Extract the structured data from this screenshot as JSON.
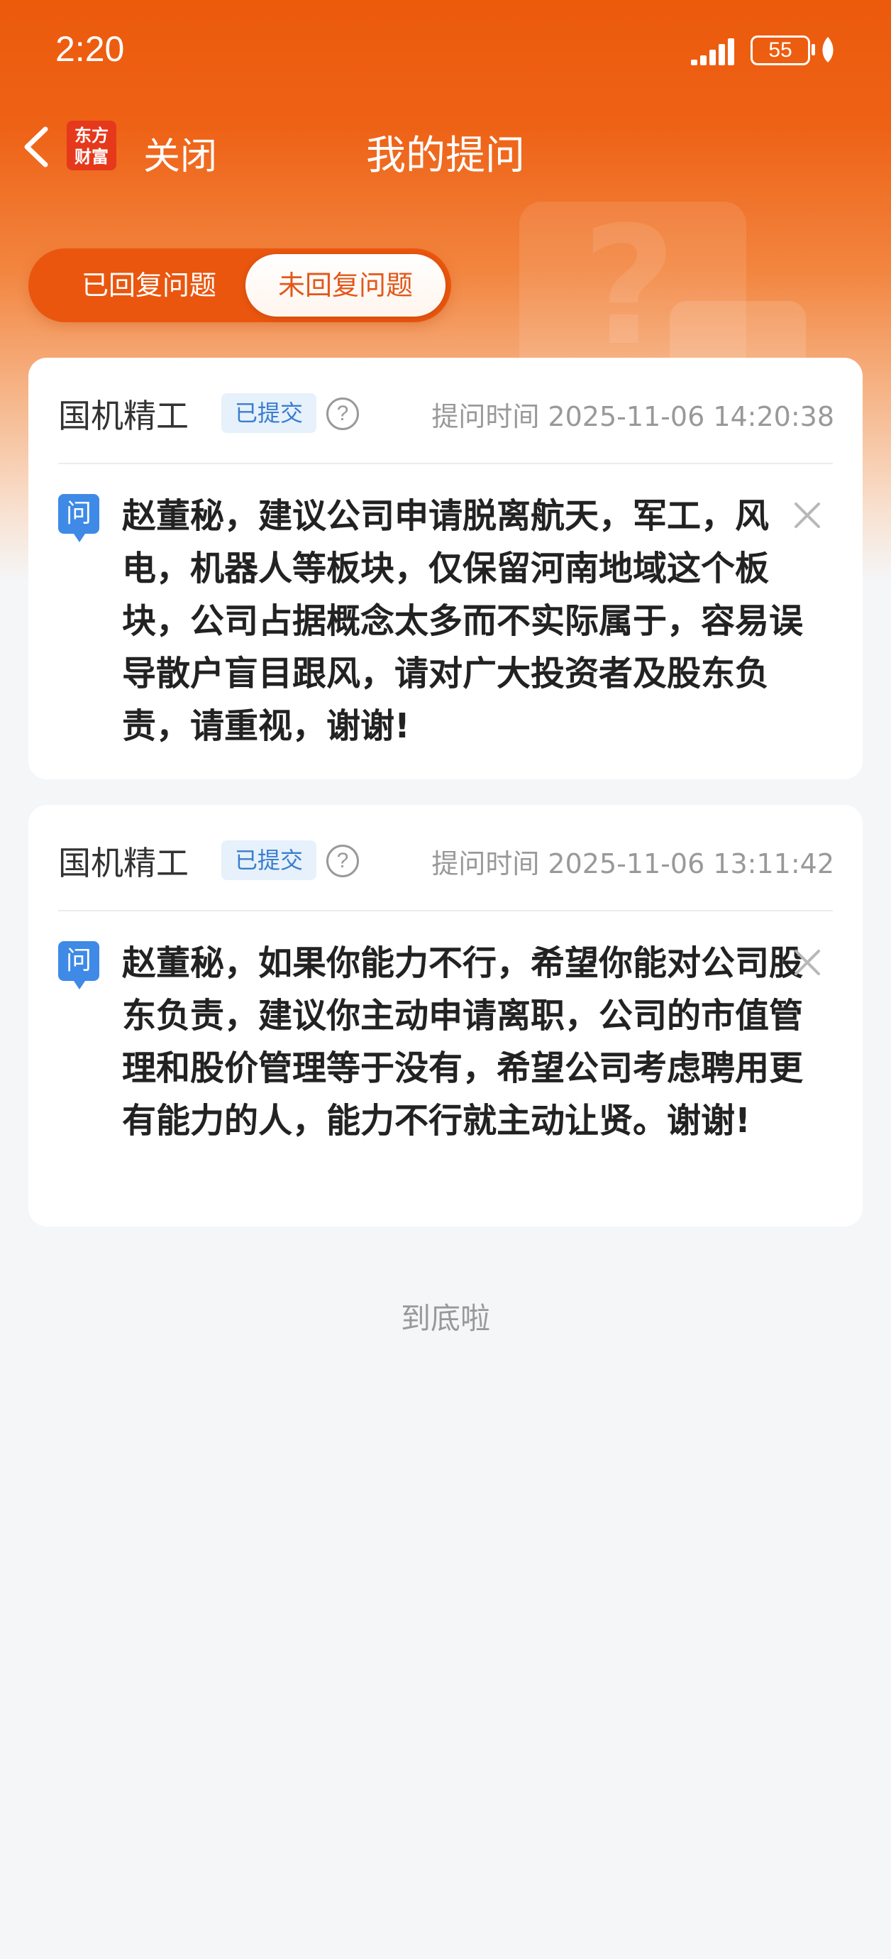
{
  "status_bar": {
    "time": "2:20",
    "battery": "55"
  },
  "nav": {
    "close_label": "关闭",
    "title": "我的提问",
    "logo_text_line1": "东方",
    "logo_text_line2": "财富"
  },
  "tabs": [
    {
      "label": "已回复问题",
      "active": false
    },
    {
      "label": "未回复问题",
      "active": true
    }
  ],
  "questions": [
    {
      "company": "国机精工",
      "status": "已提交",
      "help": "?",
      "time": "提问时间 2025-11-06 14:20:38",
      "q_badge": "问",
      "text": "赵董秘，建议公司申请脱离航天，军工，风电，机器人等板块，仅保留河南地域这个板块，公司占据概念太多而不实际属于，容易误导散户盲目跟风，请对广大投资者及股东负责，请重视，谢谢!"
    },
    {
      "company": "国机精工",
      "status": "已提交",
      "help": "?",
      "time": "提问时间 2025-11-06 13:11:42",
      "q_badge": "问",
      "text": "赵董秘，如果你能力不行，希望你能对公司股东负责，建议你主动申请离职，公司的市值管理和股价管理等于没有，希望公司考虑聘用更有能力的人，能力不行就主动让贤。谢谢!"
    }
  ],
  "footer": {
    "end_text": "到底啦"
  },
  "colors": {
    "brand": "#ec5a0c",
    "question_badge": "#3e8ae6",
    "status_badge_text": "#3a7dd0"
  }
}
